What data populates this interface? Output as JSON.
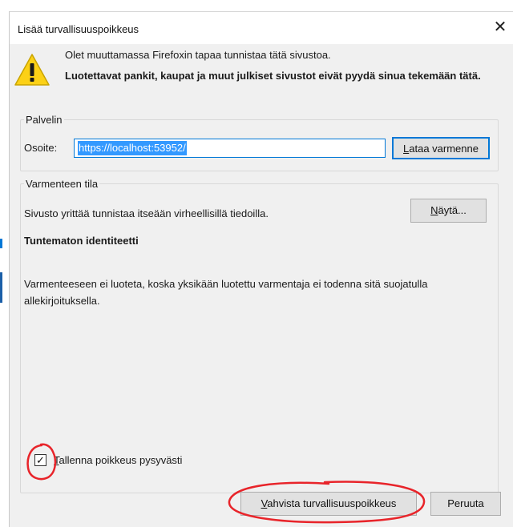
{
  "dialog": {
    "title": "Lisää turvallisuuspoikkeus",
    "close_glyph": "✕",
    "warning": {
      "icon": "warning-triangle-icon",
      "line1": "Olet muuttamassa Firefoxin tapaa tunnistaa tätä sivustoa.",
      "line2": "Luotettavat pankit, kaupat ja muut julkiset sivustot eivät pyydä sinua tekemään tätä."
    },
    "server": {
      "legend": "Palvelin",
      "address_label": "Osoite:",
      "address_value": "https://localhost:53952/",
      "load_button": {
        "mnemonic": "L",
        "rest": "ataa varmenne"
      }
    },
    "status": {
      "legend": "Varmenteen tila",
      "message": "Sivusto yrittää tunnistaa itseään virheellisillä tiedoilla.",
      "view_button": {
        "mnemonic": "N",
        "rest": "äytä..."
      },
      "identity_title": "Tuntematon identiteetti",
      "explanation": "Varmenteeseen ei luoteta, koska yksikään luotettu varmentaja ei todenna sitä suojatulla allekirjoituksella."
    },
    "permanent_checkbox": {
      "checked": true,
      "check_glyph": "✓",
      "label": {
        "mnemonic": "T",
        "rest": "allenna poikkeus pysyvästi"
      }
    },
    "confirm_button": {
      "mnemonic": "V",
      "rest": "ahvista turvallisuuspoikkeus"
    },
    "cancel_button": "Peruuta"
  },
  "colors": {
    "dialog_bg": "#f0f0f0",
    "focus_blue": "#0078d7",
    "selection_blue": "#3399ff",
    "warning_yellow": "#fcd116",
    "annotation_red": "#e8242a"
  }
}
